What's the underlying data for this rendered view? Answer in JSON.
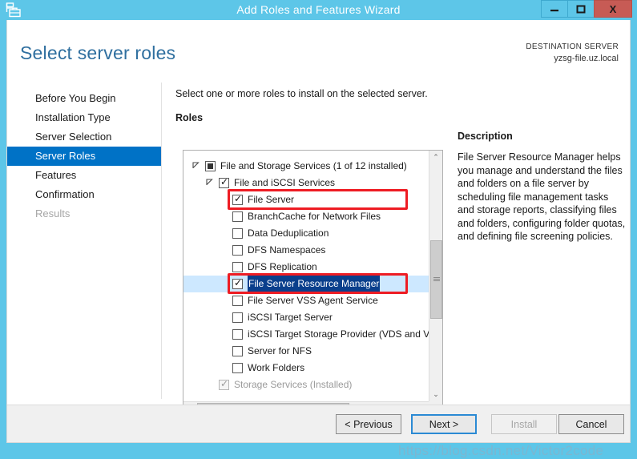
{
  "window": {
    "title": "Add Roles and Features Wizard",
    "icon": "server-roles-icon",
    "controls": {
      "minimize": "—",
      "maximize": "◻",
      "close": "X"
    }
  },
  "header": {
    "page_title": "Select server roles",
    "destination_label": "DESTINATION SERVER",
    "destination_value": "yzsg-file.uz.local"
  },
  "sidebar": {
    "items": [
      {
        "label": "Before You Begin",
        "state": "normal"
      },
      {
        "label": "Installation Type",
        "state": "normal"
      },
      {
        "label": "Server Selection",
        "state": "normal"
      },
      {
        "label": "Server Roles",
        "state": "active"
      },
      {
        "label": "Features",
        "state": "normal"
      },
      {
        "label": "Confirmation",
        "state": "normal"
      },
      {
        "label": "Results",
        "state": "disabled"
      }
    ]
  },
  "main": {
    "instruction": "Select one or more roles to install on the selected server.",
    "roles_label": "Roles",
    "tree": [
      {
        "label": "File and Storage Services (1 of 12 installed)",
        "indent": 0,
        "checkbox": "partial",
        "expander": "expanded",
        "state": "normal",
        "selected": false,
        "annotated": false
      },
      {
        "label": "File and iSCSI Services",
        "indent": 1,
        "checkbox": "checked",
        "expander": "expanded",
        "state": "normal",
        "selected": false,
        "annotated": false
      },
      {
        "label": "File Server",
        "indent": 2,
        "checkbox": "checked",
        "expander": "none",
        "state": "normal",
        "selected": false,
        "annotated": true
      },
      {
        "label": "BranchCache for Network Files",
        "indent": 2,
        "checkbox": "unchecked",
        "expander": "none",
        "state": "normal",
        "selected": false,
        "annotated": false
      },
      {
        "label": "Data Deduplication",
        "indent": 2,
        "checkbox": "unchecked",
        "expander": "none",
        "state": "normal",
        "selected": false,
        "annotated": false
      },
      {
        "label": "DFS Namespaces",
        "indent": 2,
        "checkbox": "unchecked",
        "expander": "none",
        "state": "normal",
        "selected": false,
        "annotated": false
      },
      {
        "label": "DFS Replication",
        "indent": 2,
        "checkbox": "unchecked",
        "expander": "none",
        "state": "normal",
        "selected": false,
        "annotated": false
      },
      {
        "label": "File Server Resource Manager",
        "indent": 2,
        "checkbox": "checked",
        "expander": "none",
        "state": "normal",
        "selected": true,
        "annotated": true
      },
      {
        "label": "File Server VSS Agent Service",
        "indent": 2,
        "checkbox": "unchecked",
        "expander": "none",
        "state": "normal",
        "selected": false,
        "annotated": false
      },
      {
        "label": "iSCSI Target Server",
        "indent": 2,
        "checkbox": "unchecked",
        "expander": "none",
        "state": "normal",
        "selected": false,
        "annotated": false
      },
      {
        "label": "iSCSI Target Storage Provider (VDS and VSS",
        "indent": 2,
        "checkbox": "unchecked",
        "expander": "none",
        "state": "normal",
        "selected": false,
        "annotated": false
      },
      {
        "label": "Server for NFS",
        "indent": 2,
        "checkbox": "unchecked",
        "expander": "none",
        "state": "normal",
        "selected": false,
        "annotated": false
      },
      {
        "label": "Work Folders",
        "indent": 2,
        "checkbox": "unchecked",
        "expander": "none",
        "state": "normal",
        "selected": false,
        "annotated": false
      },
      {
        "label": "Storage Services (Installed)",
        "indent": 1,
        "checkbox": "checked-disabled",
        "expander": "none",
        "state": "disabled",
        "selected": false,
        "annotated": false
      }
    ],
    "scrollbar": {
      "up_arrow": "⌃",
      "down_arrow": "⌄",
      "left_arrow": "‹",
      "right_arrow": "›"
    }
  },
  "description": {
    "title": "Description",
    "body": "File Server Resource Manager helps you manage and understand the files and folders on a file server by scheduling file management tasks and storage reports, classifying files and folders, configuring folder quotas, and defining file screening policies."
  },
  "footer": {
    "previous": "< Previous",
    "next": "Next >",
    "install": "Install",
    "cancel": "Cancel"
  },
  "watermark": {
    "text": "https://blog.csdn.net/Victor2code"
  },
  "colors": {
    "titlebar": "#5dc6e8",
    "accent": "#0072c6",
    "page_title": "#2f6f9f",
    "annotation": "#ee1c23",
    "selection_row": "#cde8ff",
    "selection_text": "#0a3f8c",
    "close_button": "#c75b55"
  }
}
